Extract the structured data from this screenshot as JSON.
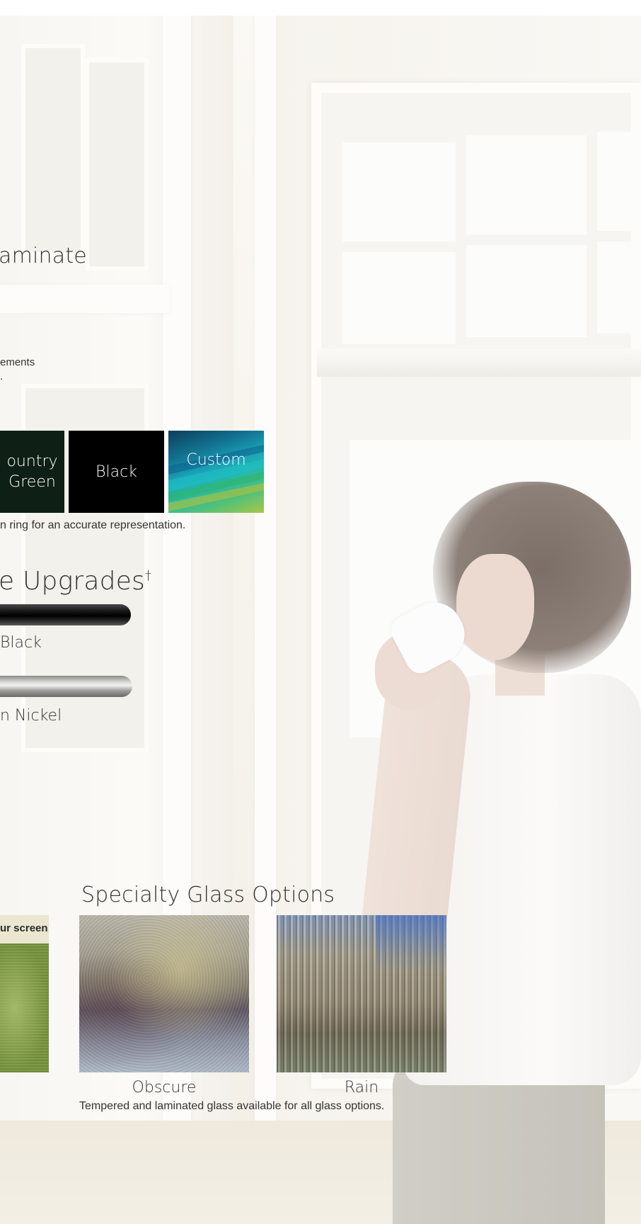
{
  "laminate": {
    "heading_fragment": "aminate",
    "note_line1": "ements",
    "note_line2": "."
  },
  "colors": {
    "swatches": [
      {
        "label": "ountry\nGreen",
        "color": "#0e1f16"
      },
      {
        "label": "Black",
        "color": "#000000"
      },
      {
        "label": "Custom",
        "color": "#1f8fa8"
      }
    ],
    "disclaimer": "n ring for an accurate representation."
  },
  "hardware": {
    "heading": "e Upgrades",
    "dagger": "†",
    "options": [
      {
        "label": "Black",
        "finish": "black"
      },
      {
        "label": "n Nickel",
        "finish": "nickel"
      }
    ]
  },
  "screen": {
    "banner_text": "ur screen!"
  },
  "specialty_glass": {
    "heading": "Specialty Glass Options",
    "options": [
      {
        "label": "Obscure"
      },
      {
        "label": "Rain"
      }
    ],
    "note": "Tempered and laminated glass available for all glass options."
  }
}
